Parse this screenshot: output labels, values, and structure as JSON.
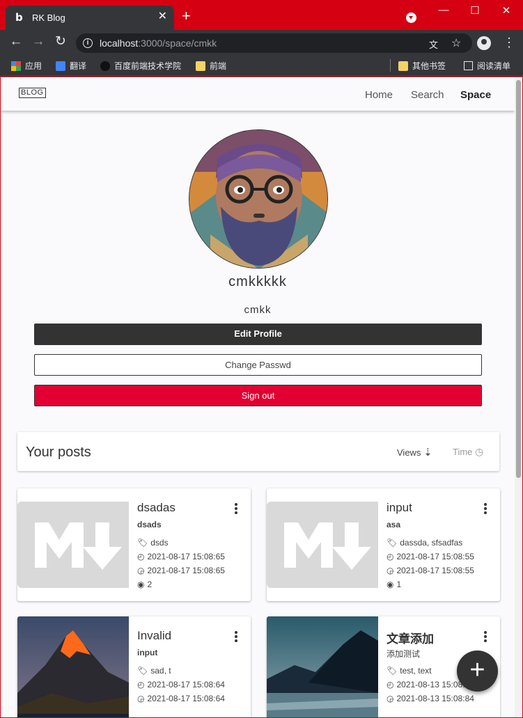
{
  "browser": {
    "tab_title": "RK Blog",
    "tab_icon": "b",
    "url_host": "localhost",
    "url_path": ":3000/space/cmkk",
    "bookmarks": [
      "应用",
      "翻译",
      "百度前端技术学院",
      "前端"
    ],
    "other_bookmarks": "其他书签",
    "reading_list": "阅读清单"
  },
  "app": {
    "logo": "BLOG",
    "nav": [
      "Home",
      "Search",
      "Space"
    ]
  },
  "profile": {
    "display_name": "cmkkkkk",
    "username": "cmkk",
    "edit_label": "Edit Profile",
    "password_label": "Change Passwd",
    "signout_label": "Sign out"
  },
  "posts_header": {
    "title": "Your posts",
    "sort_views": "Views",
    "sort_time": "Time"
  },
  "posts": [
    {
      "title": "dsadas",
      "desc": "dsads",
      "tags": "dsds",
      "created": "2021-08-17 15:08:65",
      "updated": "2021-08-17 15:08:65",
      "views": "2"
    },
    {
      "title": "input",
      "desc": "asa",
      "tags": "dassda, sfsadfas",
      "created": "2021-08-17 15:08:55",
      "updated": "2021-08-17 15:08:55",
      "views": "1"
    },
    {
      "title": "Invalid",
      "desc": "input",
      "tags": "sad, t",
      "created": "2021-08-17 15:08:64",
      "updated": "2021-08-17 15:08:64",
      "views": ""
    },
    {
      "title": "文章添加",
      "desc": "添加测试",
      "tags": "test, text",
      "created": "2021-08-13 15:08:",
      "updated": "2021-08-13 15:08:84",
      "views": ""
    }
  ],
  "colors": {
    "accent_red": "#e20032",
    "dark": "#333333",
    "browser_frame": "#d50012"
  }
}
